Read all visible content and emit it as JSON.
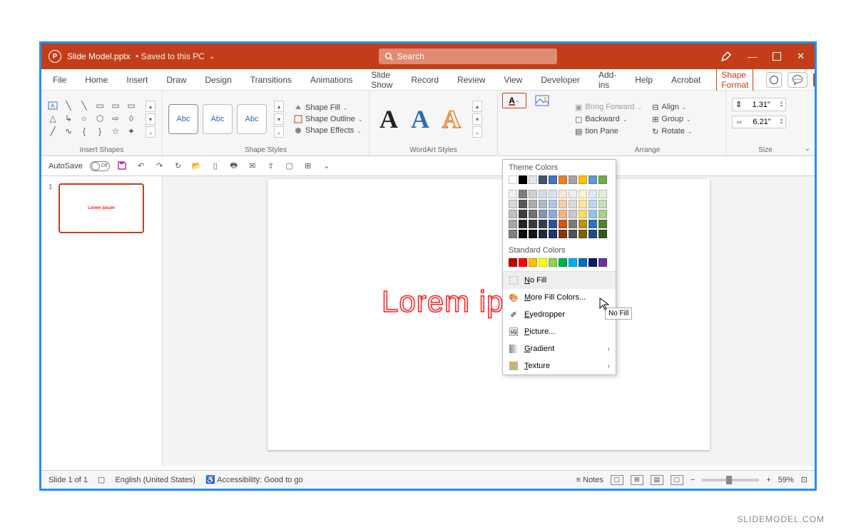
{
  "title": {
    "doc": "Slide Model.pptx",
    "saved": "Saved to this PC",
    "search_placeholder": "Search"
  },
  "tabs": [
    "File",
    "Home",
    "Insert",
    "Draw",
    "Design",
    "Transitions",
    "Animations",
    "Slide Show",
    "Record",
    "Review",
    "View",
    "Developer",
    "Add-ins",
    "Help",
    "Acrobat",
    "Shape Format"
  ],
  "ribbon": {
    "insert_shapes_label": "Insert Shapes",
    "shape_styles_label": "Shape Styles",
    "shape_styles": {
      "abc": "Abc",
      "fill": "Shape Fill",
      "outline": "Shape Outline",
      "effects": "Shape Effects"
    },
    "wordart_label": "WordArt Styles",
    "arrange_label": "Arrange",
    "arrange": {
      "bring_forward": "Bring Forward",
      "backward": "Backward",
      "pane": "tion Pane",
      "align": "Align",
      "group": "Group",
      "rotate": "Rotate"
    },
    "size_label": "Size",
    "size": {
      "h": "1.31\"",
      "w": "6.21\""
    }
  },
  "qab": {
    "autosave": "AutoSave",
    "off": "Off"
  },
  "dropdown": {
    "theme_label": "Theme Colors",
    "standard_label": "Standard Colors",
    "theme_row": [
      "#ffffff",
      "#000000",
      "#e7e6e6",
      "#44546a",
      "#4472c4",
      "#ed7d31",
      "#a5a5a5",
      "#ffc000",
      "#5b9bd5",
      "#70ad47"
    ],
    "theme_shades": [
      [
        "#f2f2f2",
        "#7f7f7f",
        "#d0cece",
        "#d6dce4",
        "#d9e2f3",
        "#fbe5d5",
        "#ededed",
        "#fff2cc",
        "#deebf6",
        "#e2efd9"
      ],
      [
        "#d8d8d8",
        "#595959",
        "#aeabab",
        "#adb9ca",
        "#b4c6e7",
        "#f7cbac",
        "#dbdbdb",
        "#fee599",
        "#bdd7ee",
        "#c5e0b3"
      ],
      [
        "#bfbfbf",
        "#3f3f3f",
        "#757070",
        "#8496b0",
        "#8eaadb",
        "#f4b183",
        "#c9c9c9",
        "#ffd965",
        "#9cc3e5",
        "#a8d08d"
      ],
      [
        "#a5a5a5",
        "#262626",
        "#3a3838",
        "#323f4f",
        "#2f5496",
        "#c55a11",
        "#7b7b7b",
        "#bf9000",
        "#2e75b5",
        "#538135"
      ],
      [
        "#7f7f7f",
        "#0c0c0c",
        "#171616",
        "#222a35",
        "#1f3864",
        "#833c0b",
        "#525252",
        "#7f6000",
        "#1e4e79",
        "#375623"
      ]
    ],
    "standard_row": [
      "#c00000",
      "#ff0000",
      "#ffc000",
      "#ffff00",
      "#92d050",
      "#00b050",
      "#00b0f0",
      "#0070c0",
      "#002060",
      "#7030a0"
    ],
    "no_fill": "No Fill",
    "more": "More Fill Colors...",
    "eyedropper": "Eyedropper",
    "picture": "Picture...",
    "gradient": "Gradient",
    "texture": "Texture"
  },
  "tooltip": "No Fill",
  "slide_text": "Lorem ip",
  "thumb_text": "Lorem ipsum",
  "thumb_num": "1",
  "status": {
    "slide": "Slide 1 of 1",
    "lang": "English (United States)",
    "acc": "Accessibility: Good to go",
    "notes": "Notes",
    "zoom": "59%"
  },
  "brand": "SLIDEMODEL.COM"
}
